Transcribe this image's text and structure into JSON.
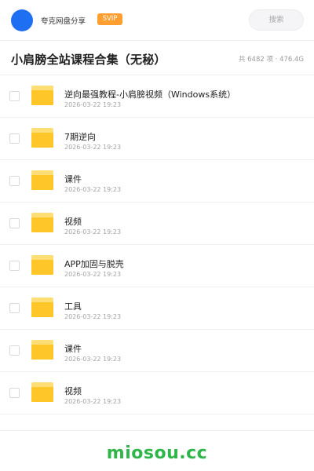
{
  "header": {
    "username": "夸克网盘分享",
    "badge": "SVIP",
    "search_placeholder": "搜索"
  },
  "title_bar": {
    "title": "小肩膀全站课程合集（无秘）",
    "meta": "共 6482 项 · 476.4G"
  },
  "files": [
    {
      "name": "逆向最强教程-小肩膀视频（Windows系统）",
      "date": "2026-03-22 19:23",
      "icon": "folder-icon"
    },
    {
      "name": "7期逆向",
      "date": "2026-03-22 19:23",
      "icon": "folder-icon"
    },
    {
      "name": "课件",
      "date": "2026-03-22 19:23",
      "icon": "folder-icon"
    },
    {
      "name": "视频",
      "date": "2026-03-22 19:23",
      "icon": "folder-icon"
    },
    {
      "name": "APP加固与脱壳",
      "date": "2026-03-22 19:23",
      "icon": "folder-icon"
    },
    {
      "name": "工具",
      "date": "2026-03-22 19:23",
      "icon": "folder-icon"
    },
    {
      "name": "课件",
      "date": "2026-03-22 19:23",
      "icon": "folder-icon"
    },
    {
      "name": "视频",
      "date": "2026-03-22 19:23",
      "icon": "folder-icon"
    }
  ],
  "footer": {
    "watermark": "miosou.cc"
  },
  "colors": {
    "avatar": "#1f6ff3",
    "badge": "#ff9f2f",
    "folder": "#ffc629",
    "watermark": "#2fb64a"
  }
}
